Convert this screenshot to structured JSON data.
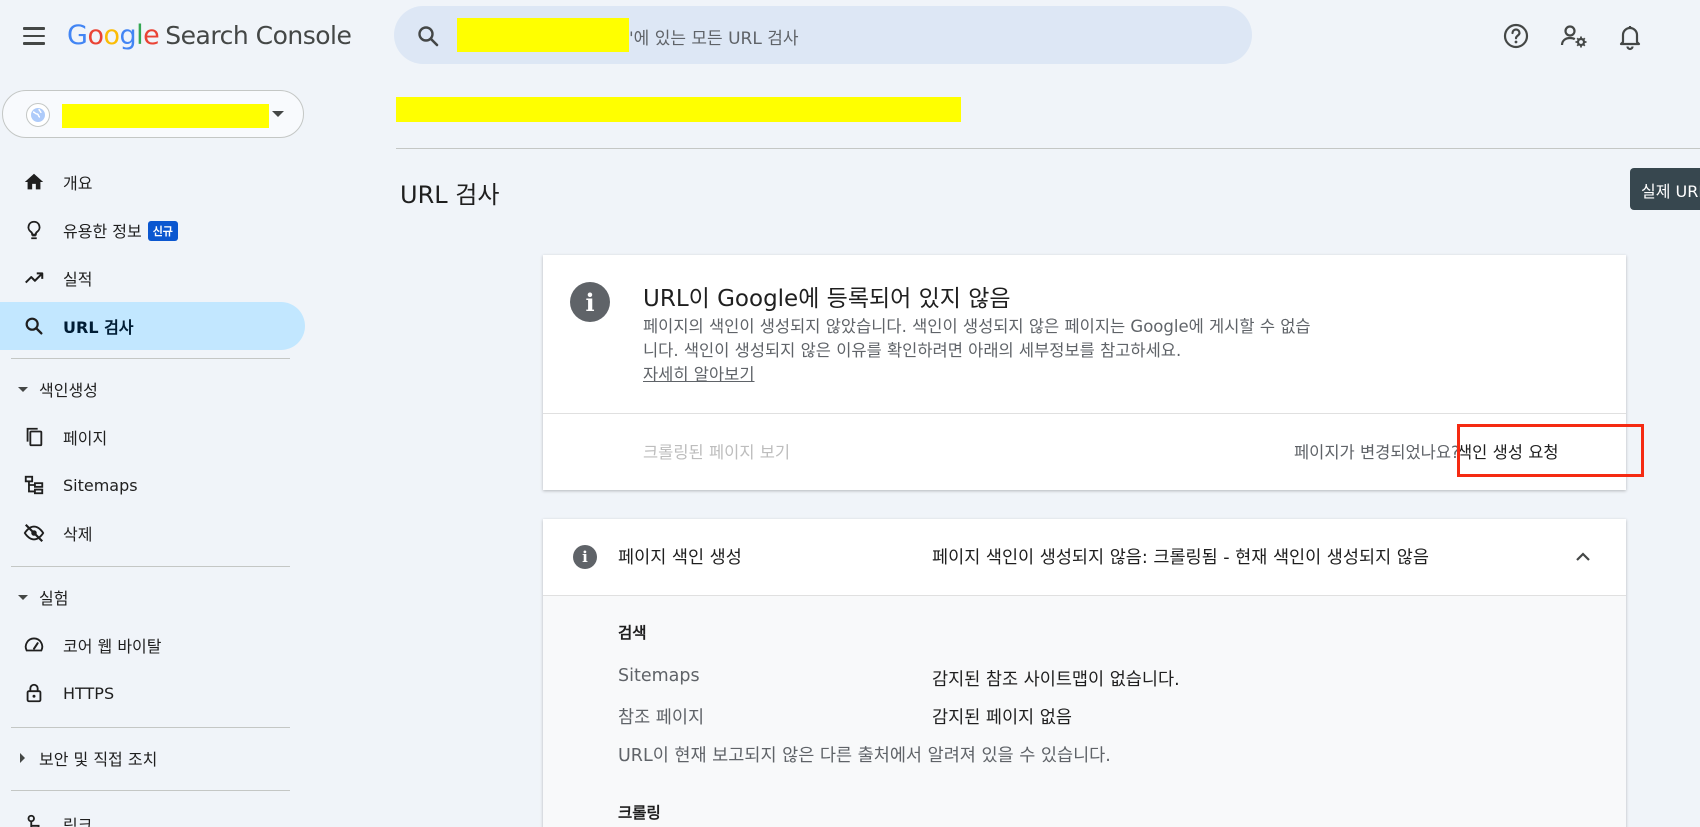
{
  "header": {
    "logo": {
      "g1": "G",
      "g2": "o",
      "g3": "o",
      "g4": "g",
      "g5": "l",
      "g6": "e",
      "product": "Search Console"
    },
    "search": {
      "suffix": "'에 있는 모든 URL 검사"
    },
    "icons": [
      "help-icon",
      "manage-users-icon",
      "notifications-icon"
    ]
  },
  "sidebar": {
    "items": [
      {
        "label": "개요",
        "icon": "home-icon"
      },
      {
        "label": "유용한 정보",
        "icon": "lightbulb-icon",
        "badge": "신규"
      },
      {
        "label": "실적",
        "icon": "trending-up-icon"
      },
      {
        "label": "URL 검사",
        "icon": "search-icon",
        "active": true
      }
    ],
    "sections": {
      "indexing": {
        "label": "색인생성",
        "items": [
          {
            "label": "페이지",
            "icon": "pages-icon"
          },
          {
            "label": "Sitemaps",
            "icon": "sitemap-icon"
          },
          {
            "label": "삭제",
            "icon": "visibility-off-icon"
          }
        ]
      },
      "experience": {
        "label": "실험",
        "items": [
          {
            "label": "코어 웹 바이탈",
            "icon": "speed-icon"
          },
          {
            "label": "HTTPS",
            "icon": "lock-icon"
          }
        ]
      },
      "security": {
        "label": "보안 및 직접 조치"
      },
      "links": {
        "label": "링크",
        "icon": "links-icon"
      }
    }
  },
  "main": {
    "page_title": "URL 검사",
    "live_test_button": "실제 URL 테스트",
    "status_card": {
      "title": "URL이 Google에 등록되어 있지 않음",
      "description": "페이지의 색인이 생성되지 않았습니다. 색인이 생성되지 않은 페이지는 Google에 게시할 수 없습니다. 색인이 생성되지 않은 이유를 확인하려면 아래의 세부정보를 참고하세요.",
      "learn_more": "자세히 알아보기",
      "view_crawled": "크롤링된 페이지 보기",
      "page_changed": "페이지가 변경되었나요?",
      "request_indexing": "색인 생성 요청"
    },
    "indexing_card": {
      "title": "페이지 색인 생성",
      "status": "페이지 색인이 생성되지 않음: 크롤링됨 - 현재 색인이 생성되지 않음",
      "discovery": {
        "label": "검색",
        "rows": [
          {
            "label": "Sitemaps",
            "value": "감지된 참조 사이트맵이 없습니다."
          },
          {
            "label": "참조 페이지",
            "value": "감지된 페이지 없음"
          }
        ],
        "note": "URL이 현재 보고되지 않은 다른 출처에서 알려져 있을 수 있습니다."
      },
      "crawl": {
        "label": "크롤링"
      }
    }
  }
}
